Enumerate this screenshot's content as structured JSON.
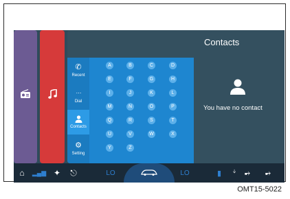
{
  "screen": {
    "title": "Contacts",
    "empty_message": "You have no contact",
    "tabs": [
      {
        "label": "Recent",
        "icon": "phone-recent-icon"
      },
      {
        "label": "Dial",
        "icon": "dialpad-icon"
      },
      {
        "label": "Contacts",
        "icon": "person-icon"
      },
      {
        "label": "Setting",
        "icon": "settings-icon"
      }
    ],
    "letters": [
      "A",
      "B",
      "C",
      "D",
      "E",
      "F",
      "G",
      "H",
      "I",
      "J",
      "K",
      "L",
      "M",
      "N",
      "O",
      "P",
      "Q",
      "R",
      "S",
      "T",
      "U",
      "V",
      "W",
      "X",
      "Y",
      "Z"
    ],
    "status": {
      "lo_left": "LO",
      "lo_right": "LO"
    }
  },
  "caption": "OMT15-5022",
  "colors": {
    "radio_panel": "#6c5b93",
    "music_panel": "#d63a3a",
    "keyboard_panel": "#1e86d0",
    "status_bar": "#1a2a38"
  }
}
